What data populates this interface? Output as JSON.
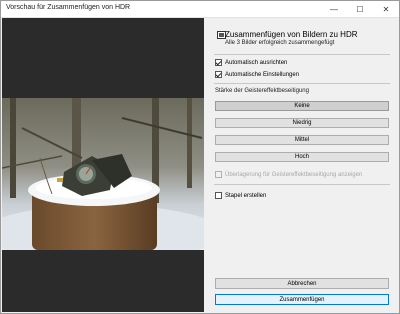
{
  "window": {
    "title": "Vorschau für Zusammenfügen von HDR",
    "minimize_glyph": "—",
    "maximize_glyph": "☐",
    "close_glyph": "✕"
  },
  "panel": {
    "header_icon": "hdr-merge-icon",
    "title": "Zusammenfügen von Bildern zu HDR",
    "subtitle": "Alle 3 Bilder erfolgreich zusammengefügt",
    "auto_align": {
      "label": "Automatisch ausrichten",
      "checked": true
    },
    "auto_settings": {
      "label": "Automatische Einstellungen",
      "checked": true
    },
    "deghost_label": "Stärke der Geistereffektbeseitigung",
    "deghost_options": [
      "Keine",
      "Niedrig",
      "Mittel",
      "Hoch"
    ],
    "deghost_selected": "Keine",
    "deghost_overlay": {
      "label": "Überlagerung für Geistereffektbeseitigung anzeigen",
      "checked": false,
      "enabled": false
    },
    "create_stack": {
      "label": "Stapel erstellen",
      "checked": false
    },
    "cancel_label": "Abbrechen",
    "merge_label": "Zusammenfügen"
  },
  "colors": {
    "accent": "#0078d7",
    "preview_background": "#2b2b2b",
    "panel_background": "#f0f0f0"
  }
}
